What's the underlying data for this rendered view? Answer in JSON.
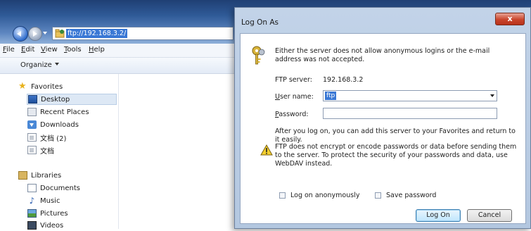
{
  "explorer": {
    "address": "ftp://192.168.3.2/",
    "menu": [
      "File",
      "Edit",
      "View",
      "Tools",
      "Help"
    ],
    "organize_label": "Organize",
    "favorites": {
      "header": "Favorites",
      "items": [
        "Desktop",
        "Recent Places",
        "Downloads",
        "文档 (2)",
        "文档"
      ]
    },
    "libraries": {
      "header": "Libraries",
      "items": [
        "Documents",
        "Music",
        "Pictures",
        "Videos"
      ]
    }
  },
  "dialog": {
    "title": "Log On As",
    "close_label": "x",
    "intro": "Either the server does not allow anonymous logins or the e-mail address was not accepted.",
    "ftp_server_label": "FTP server:",
    "ftp_server_value": "192.168.3.2",
    "user_name_label": "User name:",
    "user_name_value": "ftp",
    "password_label": "Password:",
    "password_value": "",
    "after_logon_text": "After you log on, you can add this server to your Favorites and return to it easily.",
    "warning_text": "FTP does not encrypt or encode passwords or data before sending them to the server.  To protect the security of your passwords and data, use WebDAV instead.",
    "log_on_anonymously_label": "Log on anonymously",
    "log_on_anonymously_checked": false,
    "save_password_label": "Save password",
    "save_password_checked": false,
    "log_on_button": "Log On",
    "cancel_button": "Cancel"
  },
  "colors": {
    "titlebar": "#2f5a97",
    "selection": "#3a78d5",
    "close_button": "#c9452c",
    "dialog_frame": "#b3c7e0"
  },
  "icons": [
    "back-arrow-icon",
    "forward-arrow-icon",
    "ftp-folder-icon",
    "star-icon",
    "desktop-icon",
    "recent-places-icon",
    "downloads-icon",
    "document-icon",
    "libraries-icon",
    "music-icon",
    "pictures-icon",
    "videos-icon",
    "keys-icon",
    "warning-icon"
  ]
}
